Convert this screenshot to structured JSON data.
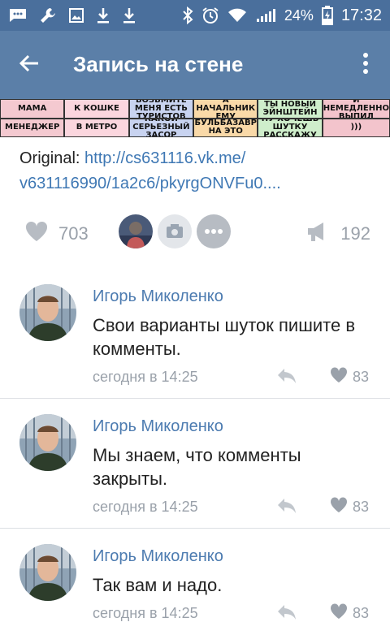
{
  "status_bar": {
    "battery_percent": "24%",
    "time": "17:32",
    "icons": [
      "chat-icon",
      "wrench-icon",
      "image-icon",
      "download-icon",
      "download-icon",
      "bluetooth-icon",
      "alarm-icon",
      "wifi-icon",
      "signal-icon",
      "battery-charging-icon"
    ]
  },
  "app_bar": {
    "title": "Запись на стене",
    "back_icon": "arrow-left-icon",
    "menu_icon": "more-vertical-icon",
    "bg_color": "#5b7fa8"
  },
  "meme": {
    "cells": [
      {
        "top": "МАМА",
        "bottom": "МЕНЕДЖЕР",
        "color": "#f4c9d0"
      },
      {
        "top": "К КОШКЕ",
        "bottom": "В МЕТРО",
        "color": "#fbd6de"
      },
      {
        "top": "ВОЗЬМИТЕ МЕНЯ ЕСТЬ ТУРИСТОВ",
        "bottom": "КАКОЙ СЕРЬЕЗНЫЙ ЗАСОР",
        "color": "#c8d3f0"
      },
      {
        "top": "А НАЧАЛЬНИК ЕМУ",
        "bottom": "БУЛЬБАЗАВР НА ЭТО",
        "color": "#f9d9a8"
      },
      {
        "top": "ТЫ НОВЫЙ ЭЙНШТЕЙН",
        "bottom": "НУ ХОЧЕШЬ ШУТКУ РАССКАЖУ",
        "color": "#cfeecb"
      },
      {
        "top": "И НЕМЕДЛЕННО ВЫПИЛ",
        "bottom": ")))",
        "color": "#f3c4cc"
      }
    ]
  },
  "original": {
    "label": "Original:",
    "link_line1": "http://cs631116.vk.me/",
    "link_line2": "v631116990/1a2c6/pkyrgONVFu0...."
  },
  "actions": {
    "likes": "703",
    "reposts": "192"
  },
  "comments": [
    {
      "author": "Игорь Миколенко",
      "text": "Свои варианты шуток пишите в комменты.",
      "time": "сегодня в 14:25",
      "likes": "83"
    },
    {
      "author": "Игорь Миколенко",
      "text": "Мы знаем, что комменты закрыты.",
      "time": "сегодня в 14:25",
      "likes": "83"
    },
    {
      "author": "Игорь Миколенко",
      "text": "Так вам и надо.",
      "time": "сегодня в 14:25",
      "likes": "83"
    }
  ]
}
